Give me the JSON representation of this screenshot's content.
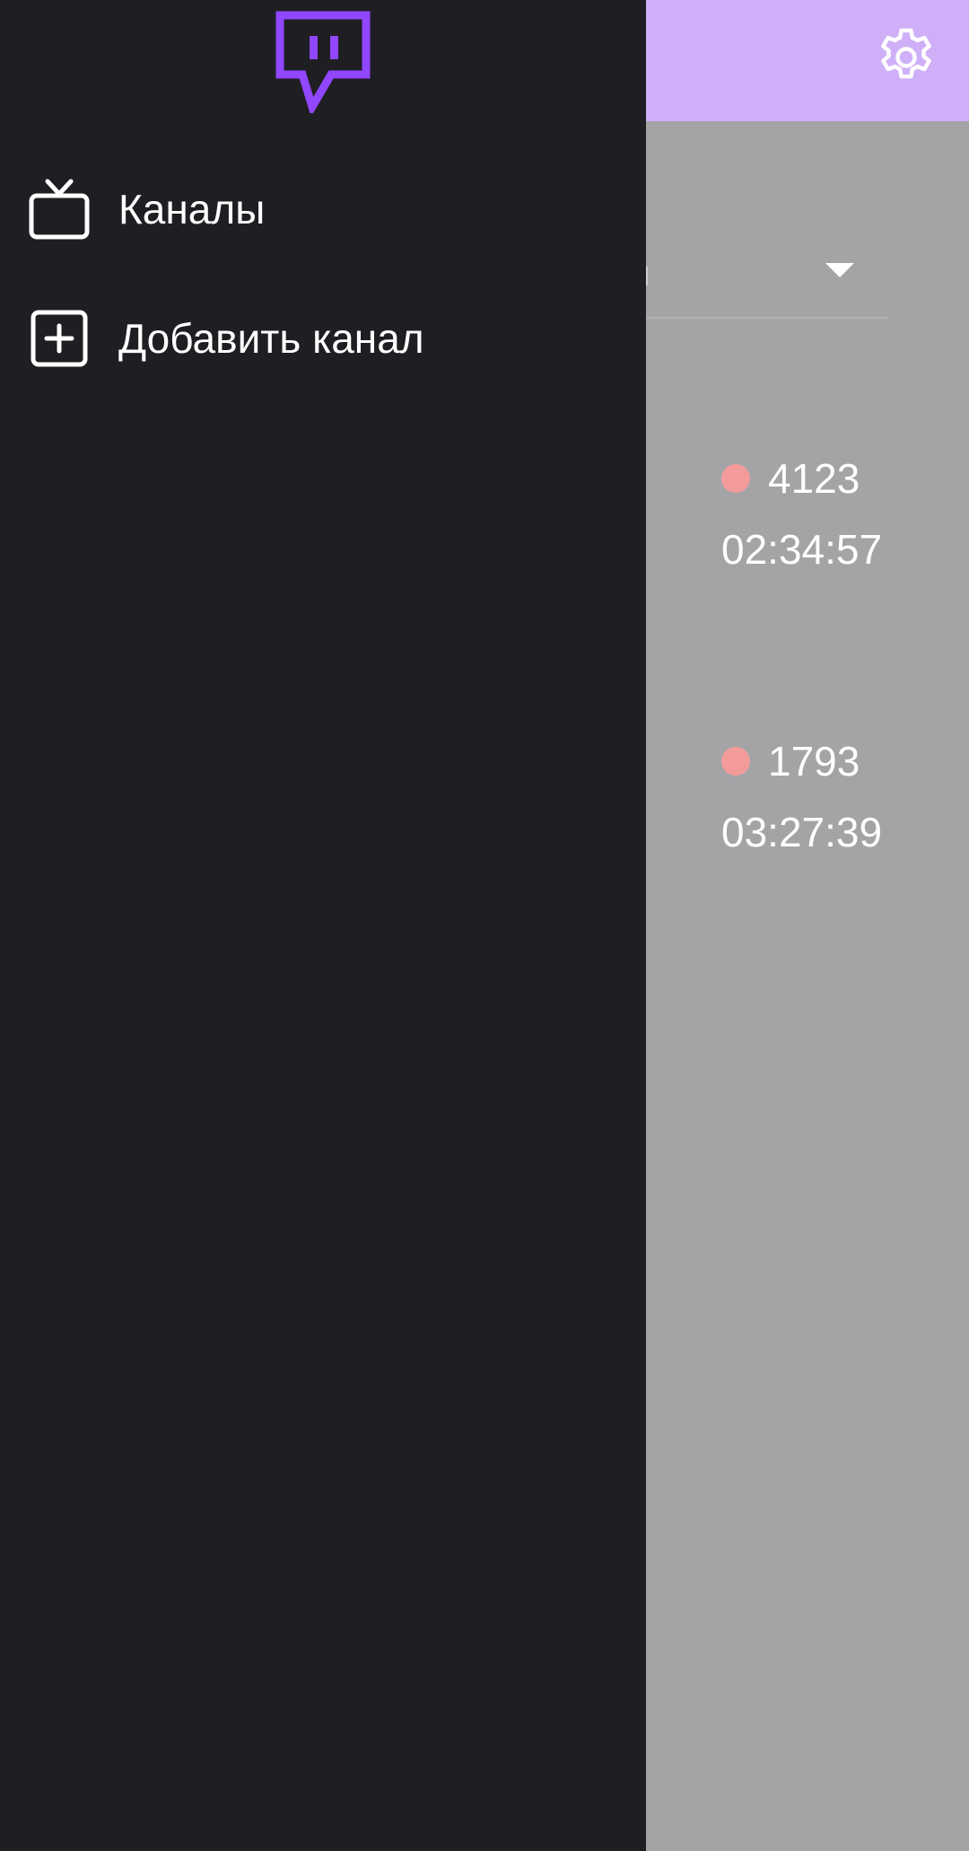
{
  "drawer": {
    "logo": "twitch-logo",
    "items": [
      {
        "label": "Каналы",
        "icon": "tv-icon"
      },
      {
        "label": "Добавить канал",
        "icon": "add-box-icon"
      }
    ]
  },
  "background": {
    "app_bar_icon": "gear-icon",
    "dropdown_value": "ин",
    "streams": [
      {
        "viewers": "4123",
        "uptime": "02:34:57"
      },
      {
        "viewers": "1793",
        "uptime": "03:27:39"
      }
    ]
  },
  "colors": {
    "accent": "#9146ff",
    "app_bar": "#cfb0f8",
    "drawer_bg": "#1f1e23",
    "live_dot": "#f39b9b"
  }
}
